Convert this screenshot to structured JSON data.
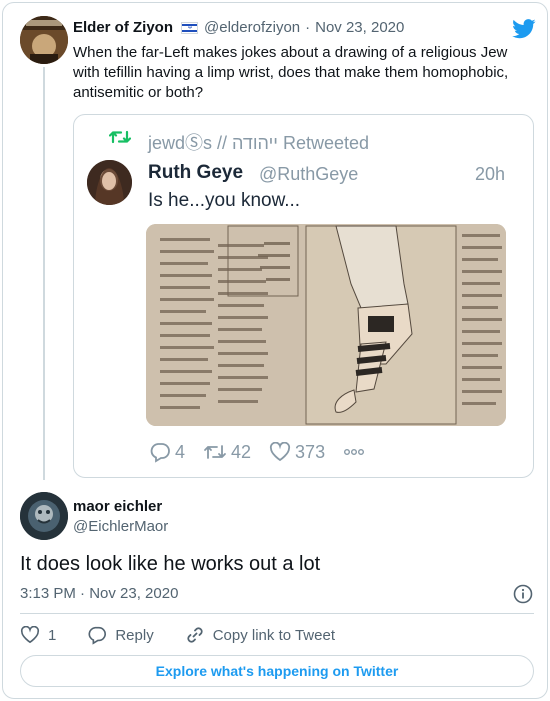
{
  "colors": {
    "accent": "#1d9bf0",
    "text": "#0f1419",
    "muted": "#536471",
    "border": "#cfd9de",
    "retweet_green": "#17bf63"
  },
  "parent_tweet": {
    "author_name": "Elder of Ziyon",
    "flag_icon": "israel-flag",
    "handle": "@elderofziyon",
    "date": "Nov 23, 2020",
    "text": "When the far-Left makes jokes about a drawing of a religious Jew with tefillin having a limp wrist, does that make them homophobic, antisemitic or both?",
    "brand_icon": "twitter-bird-icon"
  },
  "embedded_screenshot": {
    "retweeted_by": "jewdⓈs // ייהודה Retweeted",
    "author_name": "Ruth Geye",
    "handle": "@RuthGeye",
    "time": "20h",
    "text": "Is he...you know...",
    "stats": {
      "replies": "4",
      "retweets": "42",
      "likes": "373"
    }
  },
  "reply_tweet": {
    "author_name": "maor eichler",
    "handle": "@EichlerMaor",
    "text": "It does look like he works out a lot",
    "timestamp": "3:13 PM · Nov 23, 2020"
  },
  "actions": {
    "like_count": "1",
    "reply_label": "Reply",
    "copy_link_label": "Copy link to Tweet"
  },
  "footer": {
    "explore_label": "Explore what's happening on Twitter"
  }
}
